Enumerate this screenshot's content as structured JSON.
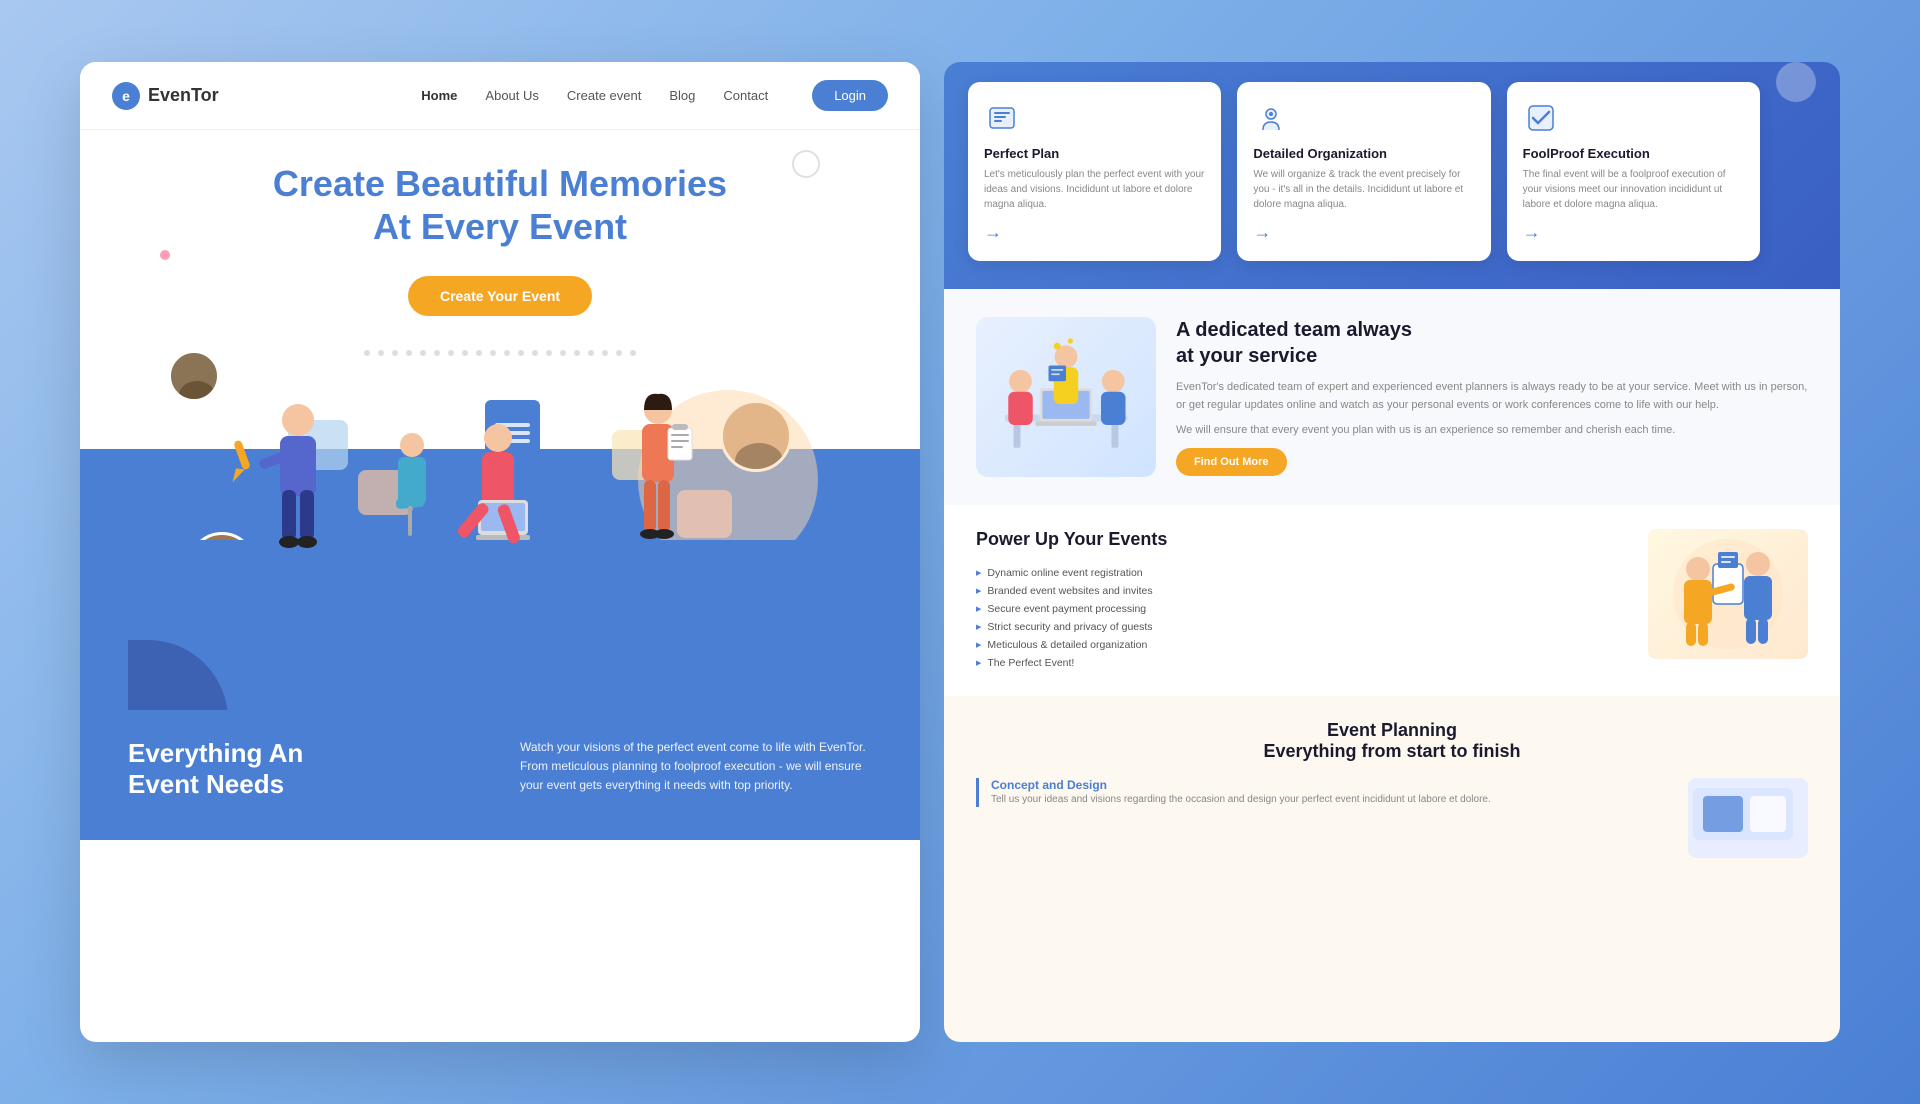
{
  "site": {
    "logo_text": "EvenTor",
    "logo_letter": "e"
  },
  "nav": {
    "links": [
      {
        "label": "Home",
        "active": true
      },
      {
        "label": "About Us",
        "active": false
      },
      {
        "label": "Create event",
        "active": false
      },
      {
        "label": "Blog",
        "active": false
      },
      {
        "label": "Contact",
        "active": false
      }
    ],
    "login_label": "Login"
  },
  "hero": {
    "title_part1": "Create Beautiful ",
    "title_highlight": "Memories",
    "title_part2": "At Every Event",
    "cta_label": "Create Your Event"
  },
  "bottom": {
    "title": "Everything An\nEvent Needs",
    "desc": "Watch your visions of the perfect event come to life with EvenTor. From meticulous planning to foolproof execution - we will ensure your event gets everything it needs with top priority."
  },
  "feature_cards": [
    {
      "title": "Perfect Plan",
      "desc": "Let's meticulously plan the perfect event with your ideas and visions. Incididunt ut labore et dolore magna aliqua.",
      "icon": "📋"
    },
    {
      "title": "Detailed Organization",
      "desc": "We will organize & track the event precisely for you - it's all in the details. Incididunt ut labore et dolore magna aliqua.",
      "icon": "📍"
    },
    {
      "title": "FoolProof Execution",
      "desc": "The final event will be a foolproof execution of your visions meet our innovation incididunt ut labore et dolore magna aliqua.",
      "icon": "✅"
    }
  ],
  "team_section": {
    "title": "A dedicated team always\nat your service",
    "desc1": "EvenTor's dedicated team of expert and experienced event planners is always ready to be at your service. Meet with us in person, or get regular updates online and watch as your personal events or work conferences come to life with our help.",
    "desc2": "We will ensure that every event you plan with us is an experience so remember and cherish each time.",
    "btn_label": "Find Out More"
  },
  "power_section": {
    "title": "Power Up Your Events",
    "features": [
      "Dynamic online event registration",
      "Branded event websites and invites",
      "Secure event payment processing",
      "Strict security and privacy of guests",
      "Meticulous & detailed organization",
      "The Perfect Event!"
    ]
  },
  "event_planning": {
    "title": "Event Planning\nEverything from start to finish",
    "concept": {
      "title": "Concept and Design",
      "desc": "Tell us your ideas and visions regarding the occasion and design your perfect event incididunt ut labore et dolore."
    }
  }
}
